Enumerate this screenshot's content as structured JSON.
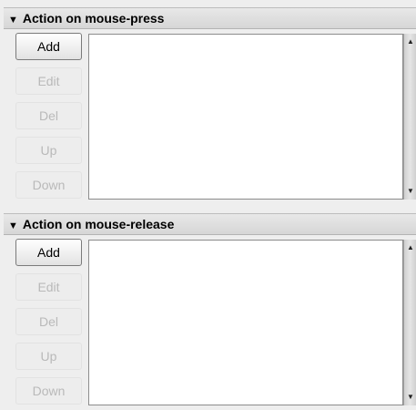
{
  "press_panel": {
    "title": "Action on mouse-press",
    "buttons": {
      "add": "Add",
      "edit": "Edit",
      "del": "Del",
      "up": "Up",
      "down": "Down"
    },
    "scroll_up_arrow": "▲",
    "scroll_down_arrow": "▼"
  },
  "release_panel": {
    "title": "Action on mouse-release",
    "buttons": {
      "add": "Add",
      "edit": "Edit",
      "del": "Del",
      "up": "Up",
      "down": "Down"
    },
    "scroll_up_arrow": "▲",
    "scroll_down_arrow": "▼"
  },
  "expander_icon": "▼"
}
